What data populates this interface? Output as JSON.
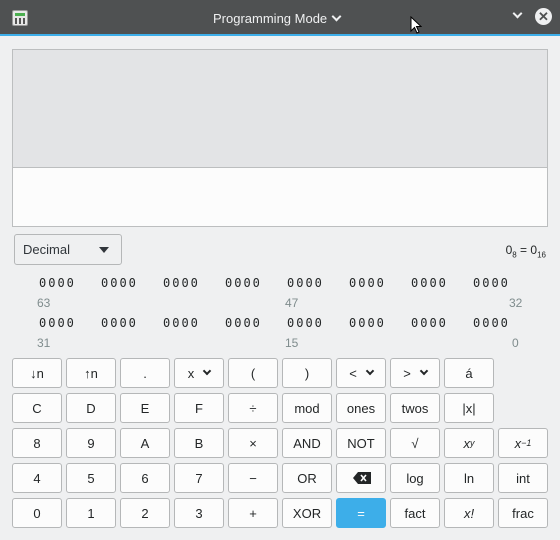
{
  "window": {
    "title": "Programming Mode"
  },
  "base_selector": {
    "value": "Decimal"
  },
  "conversion": {
    "left": "0",
    "left_sub": "8",
    "sep": "=",
    "right": "0",
    "right_sub": "16"
  },
  "bits": {
    "row1": [
      "0000",
      "0000",
      "0000",
      "0000",
      "0000",
      "0000",
      "0000",
      "0000"
    ],
    "row1_indices": [
      "63",
      "47",
      "32"
    ],
    "row2": [
      "0000",
      "0000",
      "0000",
      "0000",
      "0000",
      "0000",
      "0000",
      "0000"
    ],
    "row2_indices": [
      "31",
      "15",
      "0"
    ]
  },
  "keys": {
    "r1": [
      "↓n",
      "↑n",
      ".",
      "x",
      "(",
      ")",
      "<",
      ">",
      "á"
    ],
    "r2": [
      "C",
      "D",
      "E",
      "F",
      "÷",
      "mod",
      "ones",
      "twos",
      "|x|"
    ],
    "r3": [
      "8",
      "9",
      "A",
      "B",
      "×",
      "AND",
      "NOT",
      "√",
      "x",
      "y",
      "x",
      "−1"
    ],
    "r4": [
      "4",
      "5",
      "6",
      "7",
      "−",
      "OR",
      "",
      "log",
      "ln",
      "int"
    ],
    "r5": [
      "0",
      "1",
      "2",
      "3",
      "+",
      "XOR",
      "=",
      "fact",
      "x!",
      "frac"
    ]
  },
  "colors": {
    "accent": "#3daee9",
    "titlebar": "#4f5152"
  },
  "icons": [
    "calculator-icon",
    "chevron-down-icon",
    "close-icon",
    "backspace-icon",
    "mouse-cursor-icon"
  ]
}
